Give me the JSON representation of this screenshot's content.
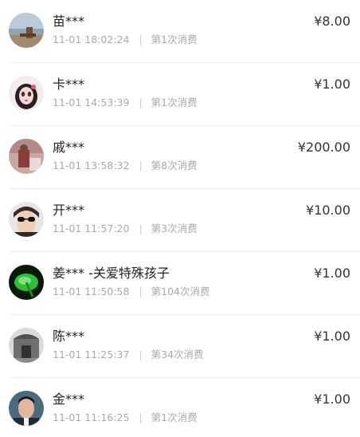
{
  "donations": [
    {
      "name": "苗***",
      "time": "11-01 18:02:24",
      "count": "第1次消费",
      "amount": "¥8.00",
      "avatar": "beach-photo-avatar"
    },
    {
      "name": "卡***",
      "time": "11-01 14:53:39",
      "count": "第1次消费",
      "amount": "¥1.00",
      "avatar": "cartoon-girl-avatar"
    },
    {
      "name": "戚***",
      "time": "11-01 13:58:32",
      "count": "第8次消费",
      "amount": "¥200.00",
      "avatar": "person-photo-avatar"
    },
    {
      "name": "开***",
      "time": "11-01 11:57:20",
      "count": "第3次消费",
      "amount": "¥10.00",
      "avatar": "sunglasses-selfie-avatar"
    },
    {
      "name": "姜*** -关爱特殊孩子",
      "time": "11-01 11:50:58",
      "count": "第104次消费",
      "amount": "¥1.00",
      "avatar": "green-leaf-avatar"
    },
    {
      "name": "陈***",
      "time": "11-01 11:25:37",
      "count": "第34次消费",
      "amount": "¥1.00",
      "avatar": "monument-photo-avatar"
    },
    {
      "name": "金***",
      "time": "11-01 11:16:25",
      "count": "第1次消费",
      "amount": "¥1.00",
      "avatar": "man-portrait-avatar"
    }
  ],
  "separator": "|"
}
